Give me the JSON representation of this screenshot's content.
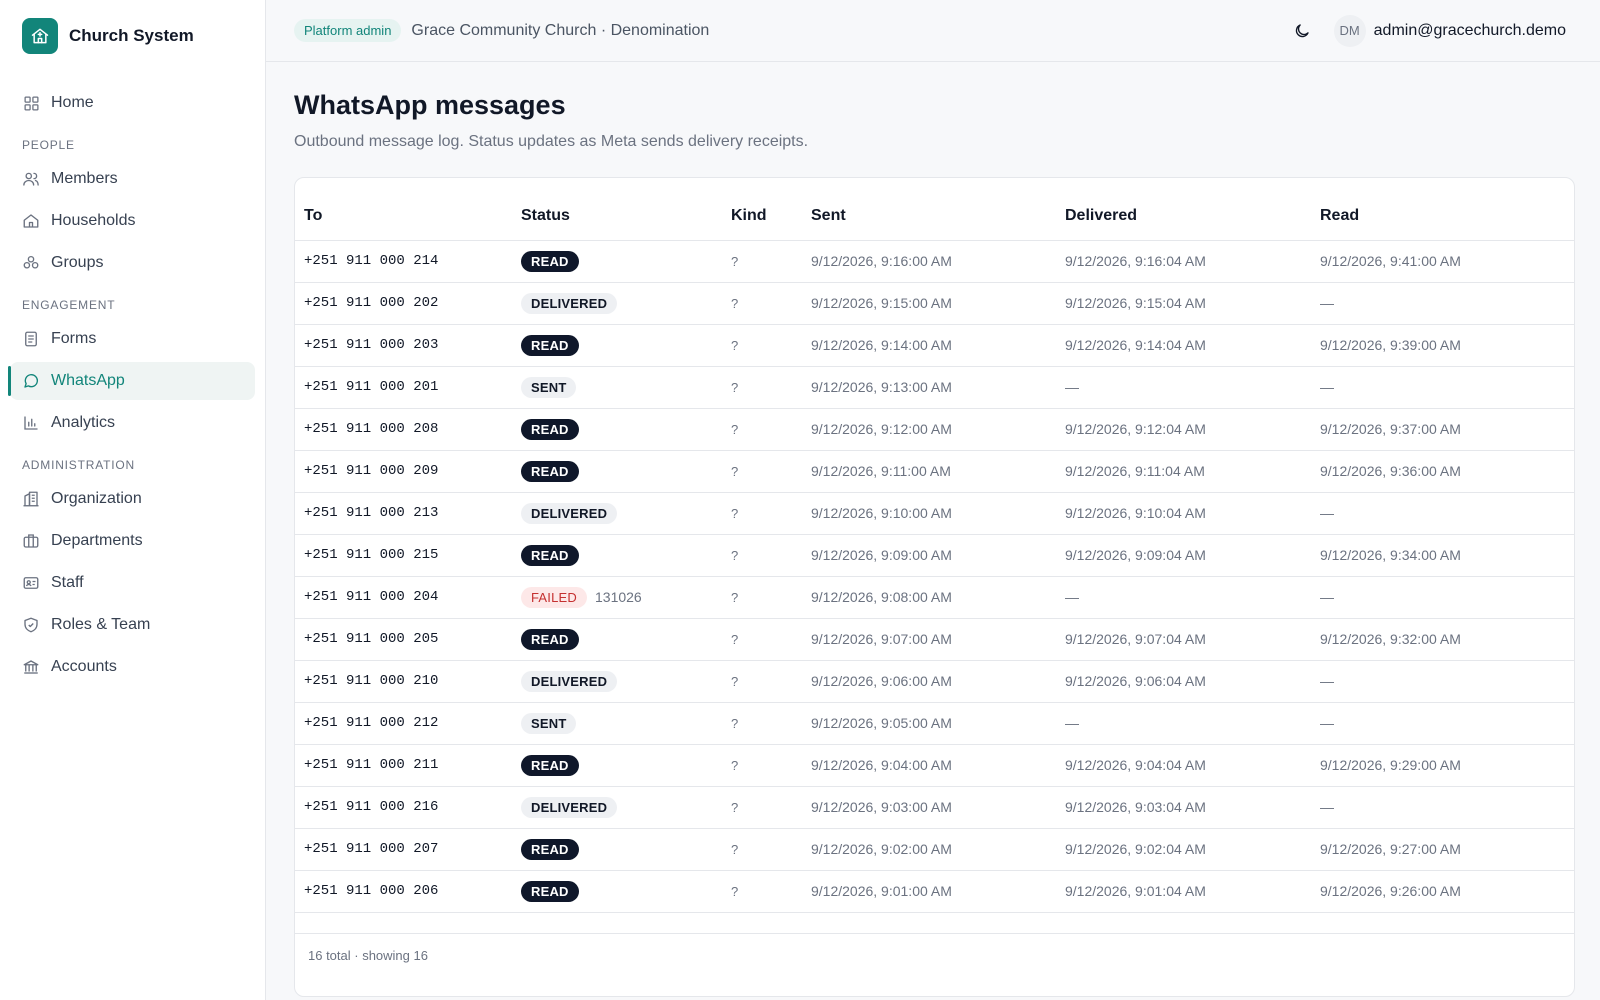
{
  "app": {
    "name": "Church System",
    "logo_icon": "church-icon",
    "accent": "#12857a"
  },
  "sidebar": {
    "home": {
      "label": "Home",
      "icon": "grid-icon"
    },
    "sections": {
      "people": "PEOPLE",
      "engagement": "ENGAGEMENT",
      "administration": "ADMINISTRATION"
    },
    "people_items": [
      {
        "label": "Members",
        "icon": "users-icon"
      },
      {
        "label": "Households",
        "icon": "house-icon"
      },
      {
        "label": "Groups",
        "icon": "groups-icon"
      }
    ],
    "engagement_items": [
      {
        "label": "Forms",
        "icon": "form-icon"
      },
      {
        "label": "WhatsApp",
        "icon": "chat-bubble-icon",
        "active": true
      },
      {
        "label": "Analytics",
        "icon": "bar-chart-icon"
      }
    ],
    "admin_items": [
      {
        "label": "Organization",
        "icon": "building-icon"
      },
      {
        "label": "Departments",
        "icon": "briefcase-icon"
      },
      {
        "label": "Staff",
        "icon": "id-card-icon"
      },
      {
        "label": "Roles & Team",
        "icon": "shield-icon"
      },
      {
        "label": "Accounts",
        "icon": "bank-icon"
      }
    ]
  },
  "header": {
    "role_badge": "Platform admin",
    "org": "Grace Community Church · Denomination",
    "avatar_initials": "DM",
    "user_email": "admin@gracechurch.demo",
    "theme_icon": "moon-icon"
  },
  "page": {
    "title": "WhatsApp messages",
    "subtitle": "Outbound message log. Status updates as Meta sends delivery receipts."
  },
  "table": {
    "columns": {
      "to": "To",
      "status": "Status",
      "kind": "Kind",
      "sent": "Sent",
      "delivered": "Delivered",
      "read": "Read"
    },
    "rows": [
      {
        "to": "+251 911 000 214",
        "status": "READ",
        "error": "",
        "kind": "?",
        "sent": "9/12/2026, 9:16:00 AM",
        "delivered": "9/12/2026, 9:16:04 AM",
        "read": "9/12/2026, 9:41:00 AM"
      },
      {
        "to": "+251 911 000 202",
        "status": "DELIVERED",
        "error": "",
        "kind": "?",
        "sent": "9/12/2026, 9:15:00 AM",
        "delivered": "9/12/2026, 9:15:04 AM",
        "read": "—"
      },
      {
        "to": "+251 911 000 203",
        "status": "READ",
        "error": "",
        "kind": "?",
        "sent": "9/12/2026, 9:14:00 AM",
        "delivered": "9/12/2026, 9:14:04 AM",
        "read": "9/12/2026, 9:39:00 AM"
      },
      {
        "to": "+251 911 000 201",
        "status": "SENT",
        "error": "",
        "kind": "?",
        "sent": "9/12/2026, 9:13:00 AM",
        "delivered": "—",
        "read": "—"
      },
      {
        "to": "+251 911 000 208",
        "status": "READ",
        "error": "",
        "kind": "?",
        "sent": "9/12/2026, 9:12:00 AM",
        "delivered": "9/12/2026, 9:12:04 AM",
        "read": "9/12/2026, 9:37:00 AM"
      },
      {
        "to": "+251 911 000 209",
        "status": "READ",
        "error": "",
        "kind": "?",
        "sent": "9/12/2026, 9:11:00 AM",
        "delivered": "9/12/2026, 9:11:04 AM",
        "read": "9/12/2026, 9:36:00 AM"
      },
      {
        "to": "+251 911 000 213",
        "status": "DELIVERED",
        "error": "",
        "kind": "?",
        "sent": "9/12/2026, 9:10:00 AM",
        "delivered": "9/12/2026, 9:10:04 AM",
        "read": "—"
      },
      {
        "to": "+251 911 000 215",
        "status": "READ",
        "error": "",
        "kind": "?",
        "sent": "9/12/2026, 9:09:00 AM",
        "delivered": "9/12/2026, 9:09:04 AM",
        "read": "9/12/2026, 9:34:00 AM"
      },
      {
        "to": "+251 911 000 204",
        "status": "FAILED",
        "error": "131026",
        "kind": "?",
        "sent": "9/12/2026, 9:08:00 AM",
        "delivered": "—",
        "read": "—"
      },
      {
        "to": "+251 911 000 205",
        "status": "READ",
        "error": "",
        "kind": "?",
        "sent": "9/12/2026, 9:07:00 AM",
        "delivered": "9/12/2026, 9:07:04 AM",
        "read": "9/12/2026, 9:32:00 AM"
      },
      {
        "to": "+251 911 000 210",
        "status": "DELIVERED",
        "error": "",
        "kind": "?",
        "sent": "9/12/2026, 9:06:00 AM",
        "delivered": "9/12/2026, 9:06:04 AM",
        "read": "—"
      },
      {
        "to": "+251 911 000 212",
        "status": "SENT",
        "error": "",
        "kind": "?",
        "sent": "9/12/2026, 9:05:00 AM",
        "delivered": "—",
        "read": "—"
      },
      {
        "to": "+251 911 000 211",
        "status": "READ",
        "error": "",
        "kind": "?",
        "sent": "9/12/2026, 9:04:00 AM",
        "delivered": "9/12/2026, 9:04:04 AM",
        "read": "9/12/2026, 9:29:00 AM"
      },
      {
        "to": "+251 911 000 216",
        "status": "DELIVERED",
        "error": "",
        "kind": "?",
        "sent": "9/12/2026, 9:03:00 AM",
        "delivered": "9/12/2026, 9:03:04 AM",
        "read": "—"
      },
      {
        "to": "+251 911 000 207",
        "status": "READ",
        "error": "",
        "kind": "?",
        "sent": "9/12/2026, 9:02:00 AM",
        "delivered": "9/12/2026, 9:02:04 AM",
        "read": "9/12/2026, 9:27:00 AM"
      },
      {
        "to": "+251 911 000 206",
        "status": "READ",
        "error": "",
        "kind": "?",
        "sent": "9/12/2026, 9:01:00 AM",
        "delivered": "9/12/2026, 9:01:04 AM",
        "read": "9/12/2026, 9:26:00 AM"
      }
    ],
    "footer": "16 total · showing 16"
  }
}
